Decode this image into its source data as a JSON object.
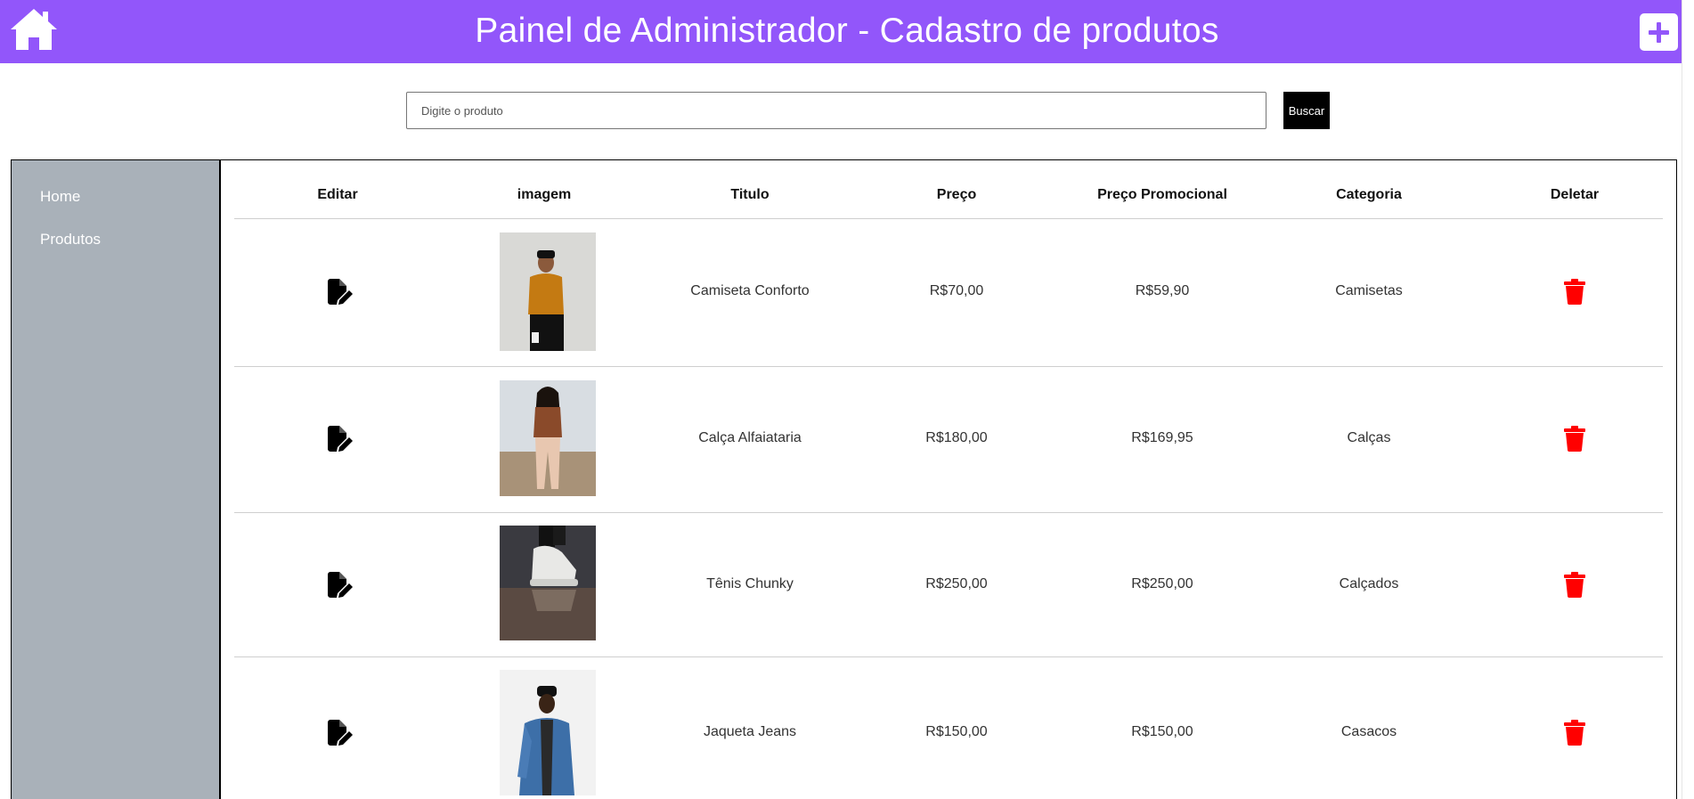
{
  "header": {
    "title": "Painel de Administrador - Cadastro de produtos",
    "home_icon": "home-icon",
    "add_icon": "plus-icon",
    "accent_color": "#9256fa"
  },
  "search": {
    "placeholder": "Digite o produto",
    "value": "",
    "button_label": "Buscar"
  },
  "sidebar": {
    "items": [
      {
        "label": "Home"
      },
      {
        "label": "Produtos"
      }
    ]
  },
  "table": {
    "columns": [
      "Editar",
      "imagem",
      "Titulo",
      "Preço",
      "Preço Promocional",
      "Categoria",
      "Deletar"
    ],
    "rows": [
      {
        "titulo": "Camiseta Conforto",
        "preco": "R$70,00",
        "preco_promocional": "R$59,90",
        "categoria": "Camisetas",
        "image_icon": "product-photo-tshirt"
      },
      {
        "titulo": "Calça Alfaiataria",
        "preco": "R$180,00",
        "preco_promocional": "R$169,95",
        "categoria": "Calças",
        "image_icon": "product-photo-pants"
      },
      {
        "titulo": "Tênis Chunky",
        "preco": "R$250,00",
        "preco_promocional": "R$250,00",
        "categoria": "Calçados",
        "image_icon": "product-photo-sneakers"
      },
      {
        "titulo": "Jaqueta Jeans",
        "preco": "R$150,00",
        "preco_promocional": "R$150,00",
        "categoria": "Casacos",
        "image_icon": "product-photo-jacket"
      }
    ],
    "edit_icon": "edit-file-icon",
    "delete_icon": "trash-icon",
    "delete_color": "#ff0000"
  }
}
